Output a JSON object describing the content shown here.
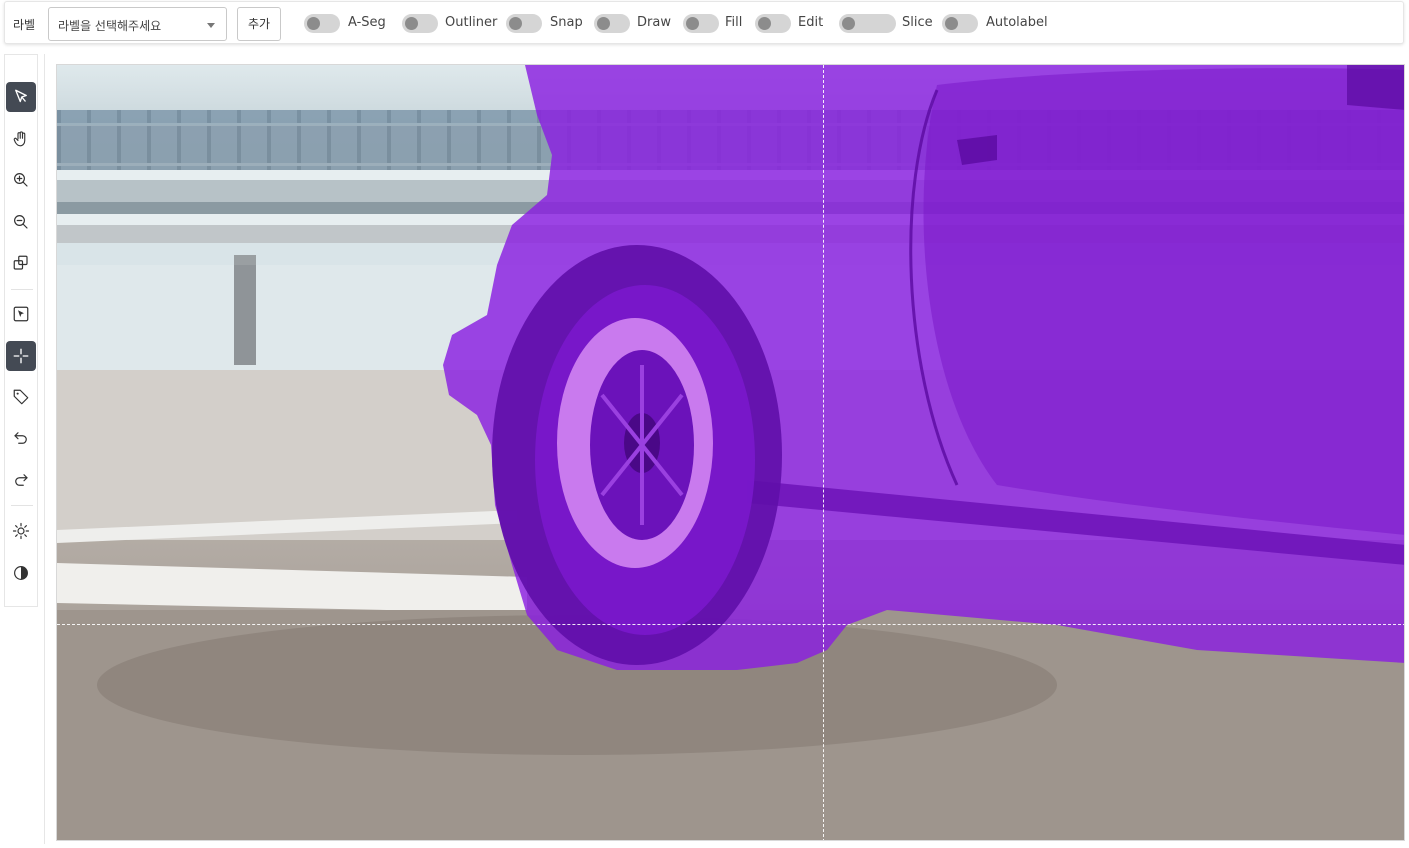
{
  "toolbar": {
    "label_title": "라벨",
    "select_placeholder": "라벨을 선택해주세요",
    "add_button": "추가",
    "toggles": [
      {
        "label": "A-Seg",
        "on": false
      },
      {
        "label": "Outliner",
        "on": false
      },
      {
        "label": "Snap",
        "on": false
      },
      {
        "label": "Draw",
        "on": false
      },
      {
        "label": "Fill",
        "on": false
      },
      {
        "label": "Edit",
        "on": false
      },
      {
        "label": "Slice",
        "on": false
      },
      {
        "label": "Autolabel",
        "on": false
      }
    ]
  },
  "sidebar": {
    "tools": [
      {
        "icon": "pointer-icon",
        "active": true
      },
      {
        "icon": "hand-icon",
        "active": false
      },
      {
        "icon": "zoom-in-icon",
        "active": false
      },
      {
        "icon": "zoom-out-icon",
        "active": false
      },
      {
        "icon": "copy-icon",
        "active": false
      },
      {
        "icon": "select-box-icon",
        "active": false
      },
      {
        "icon": "crosshair-icon",
        "active": true
      },
      {
        "icon": "tag-icon",
        "active": false
      },
      {
        "icon": "undo-icon",
        "active": false
      },
      {
        "icon": "redo-icon",
        "active": false
      },
      {
        "icon": "brightness-icon",
        "active": false
      },
      {
        "icon": "contrast-icon",
        "active": false
      }
    ]
  },
  "canvas": {
    "mask_color": "#8a1ee0",
    "wheel_highlight_color": "#c97aee"
  }
}
